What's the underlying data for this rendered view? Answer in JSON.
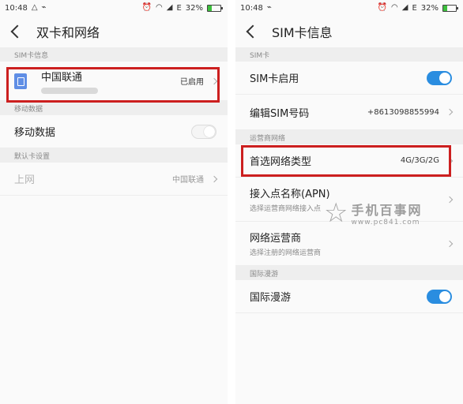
{
  "colors": {
    "accent": "#2a8de0",
    "highlight": "#cc1f1f",
    "sim_icon": "#5f8ee5"
  },
  "status_bar": {
    "time": "10:48",
    "network": "E",
    "battery_percent": 0.32,
    "battery_text": "32%"
  },
  "left_screen": {
    "title": "双卡和网络",
    "sim_header": "SIM卡信息",
    "sim_card": {
      "name": "中国联通",
      "status": "已启用"
    },
    "mobile_data_header": "移动数据",
    "mobile_data": {
      "label": "移动数据",
      "enabled": false
    },
    "default_card_header": "默认卡设置",
    "internet": {
      "label": "上网",
      "value": "中国联通"
    }
  },
  "right_screen": {
    "title": "SIM卡信息",
    "sim_header": "SIM卡",
    "sim_enable": {
      "label": "SIM卡启用",
      "enabled": true
    },
    "edit_number": {
      "label": "编辑SIM号码",
      "value": "+8613098855994"
    },
    "carrier_header": "运营商网络",
    "preferred_network": {
      "label": "首选网络类型",
      "value": "4G/3G/2G"
    },
    "apn": {
      "label": "接入点名称(APN)",
      "sub": "选择运营商网络接入点"
    },
    "network_operator": {
      "label": "网络运营商",
      "sub": "选择注册的网络运营商"
    },
    "roaming_header": "国际漫游",
    "roaming": {
      "label": "国际漫游",
      "enabled": true
    }
  },
  "watermark": {
    "title": "手机百事网",
    "url": "www.pc841.com"
  }
}
